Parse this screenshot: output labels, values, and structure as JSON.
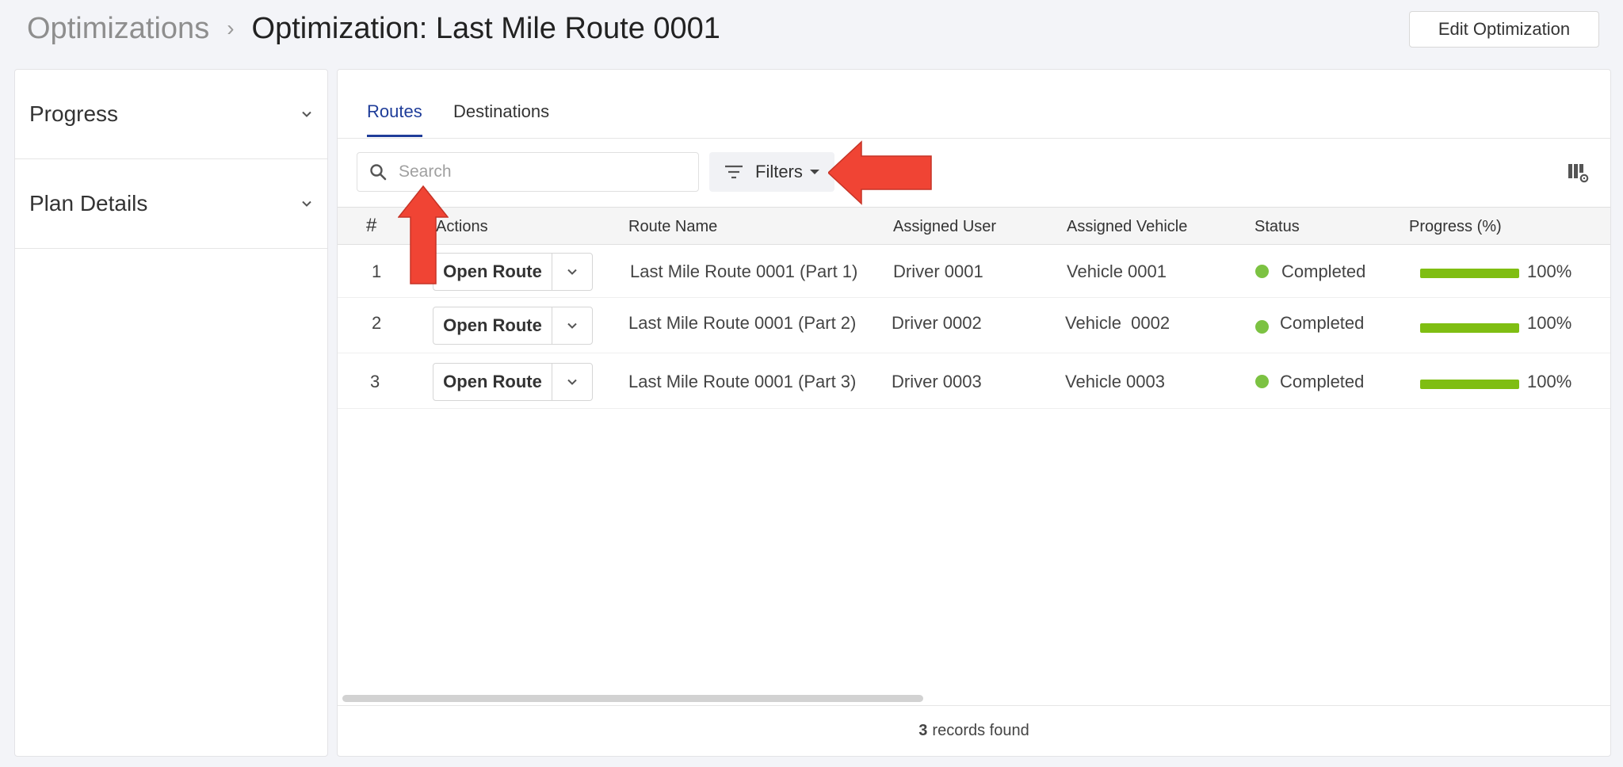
{
  "breadcrumb": {
    "parent": "Optimizations",
    "separator": "›",
    "current": "Optimization: Last Mile Route 0001"
  },
  "header": {
    "edit_button": "Edit Optimization"
  },
  "sidebar": {
    "items": [
      {
        "label": "Progress",
        "icon": "chevron-down-icon"
      },
      {
        "label": "Plan Details",
        "icon": "chevron-down-icon"
      }
    ]
  },
  "tabs": [
    {
      "label": "Routes",
      "active": true
    },
    {
      "label": "Destinations",
      "active": false
    }
  ],
  "search": {
    "placeholder": "Search",
    "value": "",
    "icon": "search-icon"
  },
  "filters": {
    "label": "Filters",
    "icon": "filter-icon"
  },
  "table": {
    "columns": [
      "#",
      "Actions",
      "Route Name",
      "Assigned User",
      "Assigned Vehicle",
      "Status",
      "Progress (%)"
    ],
    "rows": [
      {
        "num": "1",
        "action": "Open Route",
        "route_name": "Last Mile Route 0001 (Part 1)",
        "user": "Driver 0001",
        "vehicle": "Vehicle 0001",
        "status": "Completed",
        "progress": "100%",
        "progress_value": 100
      },
      {
        "num": "2",
        "action": "Open Route",
        "route_name": "Last Mile Route 0001 (Part 2)",
        "user": "Driver 0002",
        "vehicle": "Vehicle  0002",
        "status": "Completed",
        "progress": "100%",
        "progress_value": 100
      },
      {
        "num": "3",
        "action": "Open Route",
        "route_name": "Last Mile Route 0001 (Part 3)",
        "user": "Driver 0003",
        "vehicle": "Vehicle 0003",
        "status": "Completed",
        "progress": "100%",
        "progress_value": 100
      }
    ]
  },
  "footer": {
    "count": "3",
    "text": "records found"
  },
  "colors": {
    "accent": "#1f3d99",
    "status_completed": "#7cc242",
    "progress_fill": "#7fbe12",
    "annotation_arrow": "#f04434"
  }
}
